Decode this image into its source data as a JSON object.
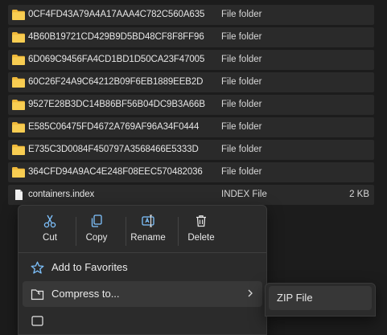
{
  "files": [
    {
      "name": "0CF4FD43A79A4A17AAA4C782C560A635",
      "type": "File folder",
      "size": "",
      "icon": "folder-icon"
    },
    {
      "name": "4B60B19721CD429B9D5BD48CF8F8FF96",
      "type": "File folder",
      "size": "",
      "icon": "folder-icon"
    },
    {
      "name": "6D069C9456FA4CD1BD1D50CA23F47005",
      "type": "File folder",
      "size": "",
      "icon": "folder-icon"
    },
    {
      "name": "60C26F24A9C64212B09F6EB1889EEB2D",
      "type": "File folder",
      "size": "",
      "icon": "folder-icon"
    },
    {
      "name": "9527E28B3DC14B86BF56B04DC9B3A66B",
      "type": "File folder",
      "size": "",
      "icon": "folder-icon"
    },
    {
      "name": "E585C06475FD4672A769AF96A34F0444",
      "type": "File folder",
      "size": "",
      "icon": "folder-icon"
    },
    {
      "name": "E735C3D0084F450797A3568466E5333D",
      "type": "File folder",
      "size": "",
      "icon": "folder-icon"
    },
    {
      "name": "364CFD94A9AC4E248F08EEC570482036",
      "type": "File folder",
      "size": "",
      "icon": "folder-icon"
    },
    {
      "name": "containers.index",
      "type": "INDEX File",
      "size": "2 KB",
      "icon": "file-icon"
    }
  ],
  "context_menu": {
    "quick_actions": [
      {
        "label": "Cut",
        "icon": "scissors-icon"
      },
      {
        "label": "Copy",
        "icon": "copy-icon"
      },
      {
        "label": "Rename",
        "icon": "rename-icon"
      },
      {
        "label": "Delete",
        "icon": "trash-icon"
      }
    ],
    "items": [
      {
        "label": "Add to Favorites",
        "icon": "star-icon"
      },
      {
        "label": "Compress to...",
        "icon": "zip-folder-icon",
        "has_submenu": true
      },
      {
        "label": "",
        "icon": "path-icon"
      }
    ]
  },
  "submenu": {
    "items": [
      {
        "label": "ZIP File"
      }
    ]
  },
  "colors": {
    "background": "#1c1c1c",
    "row": "#2a2a2a",
    "menu": "#2b2b2b",
    "folder_yellow": "#f5c542",
    "accent_blue": "#60b0f0"
  }
}
